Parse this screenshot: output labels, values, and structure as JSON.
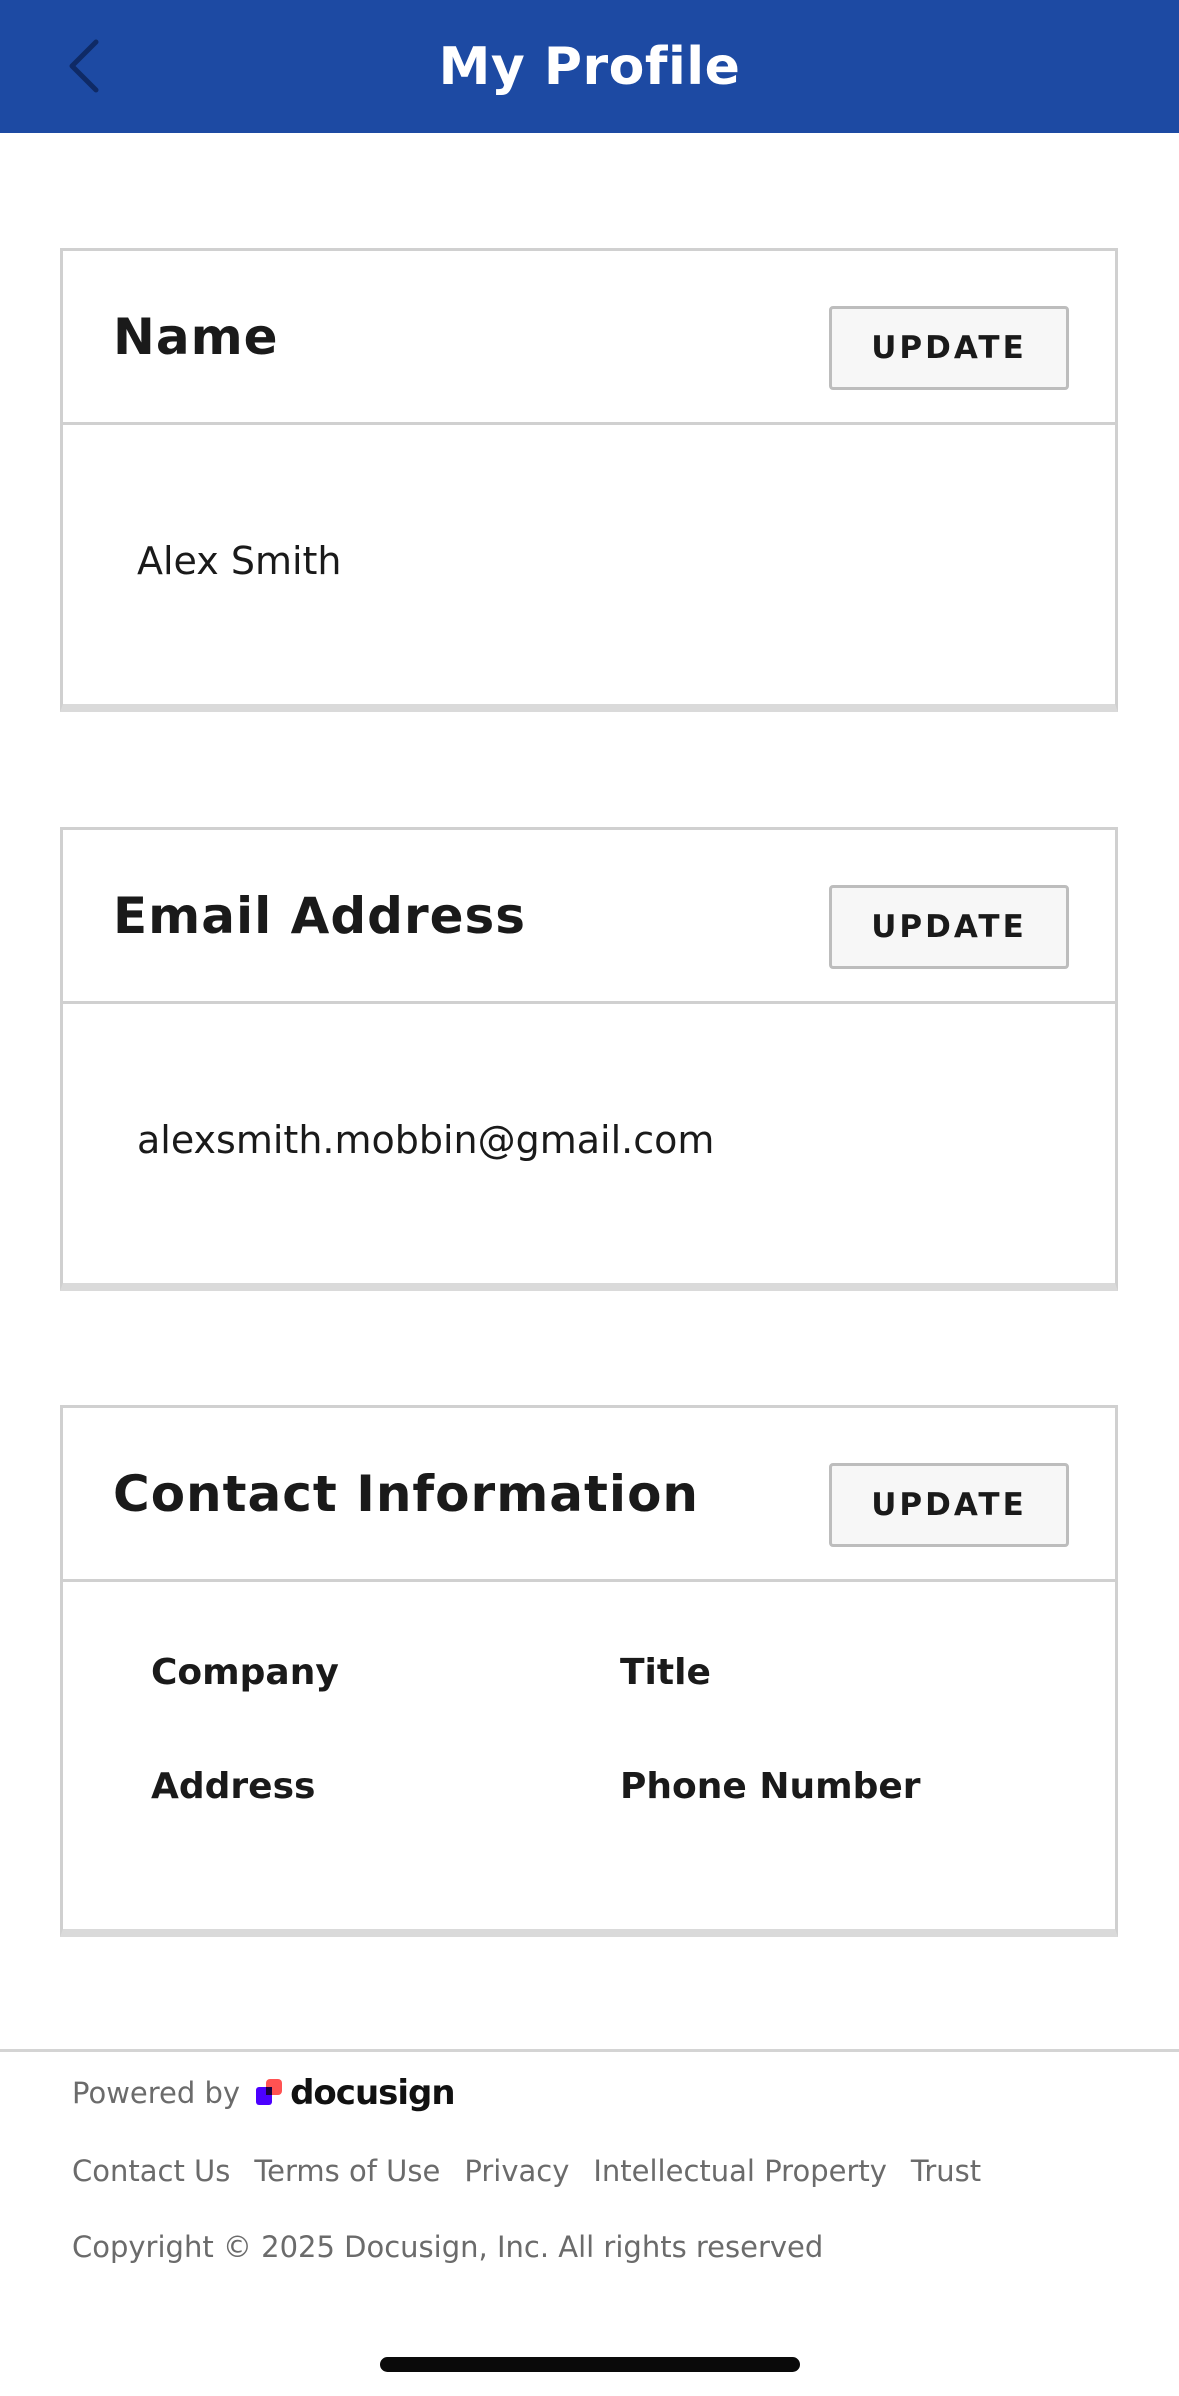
{
  "header": {
    "title": "My Profile",
    "back_icon": "chevron-left-icon",
    "background": "#1d4aa3"
  },
  "name_card": {
    "title": "Name",
    "update_label": "UPDATE",
    "value": "Alex Smith"
  },
  "email_card": {
    "title": "Email Address",
    "update_label": "UPDATE",
    "value": "alexsmith.mobbin@gmail.com"
  },
  "contact_card": {
    "title": "Contact Information",
    "update_label": "UPDATE",
    "labels": {
      "company": "Company",
      "title": "Title",
      "address": "Address",
      "phone": "Phone Number"
    }
  },
  "footer": {
    "powered_by": "Powered by",
    "brand": "docusign",
    "links": [
      "Contact Us",
      "Terms of Use",
      "Privacy",
      "Intellectual Property",
      "Trust"
    ],
    "copyright": "Copyright © 2025 Docusign, Inc. All rights reserved"
  }
}
